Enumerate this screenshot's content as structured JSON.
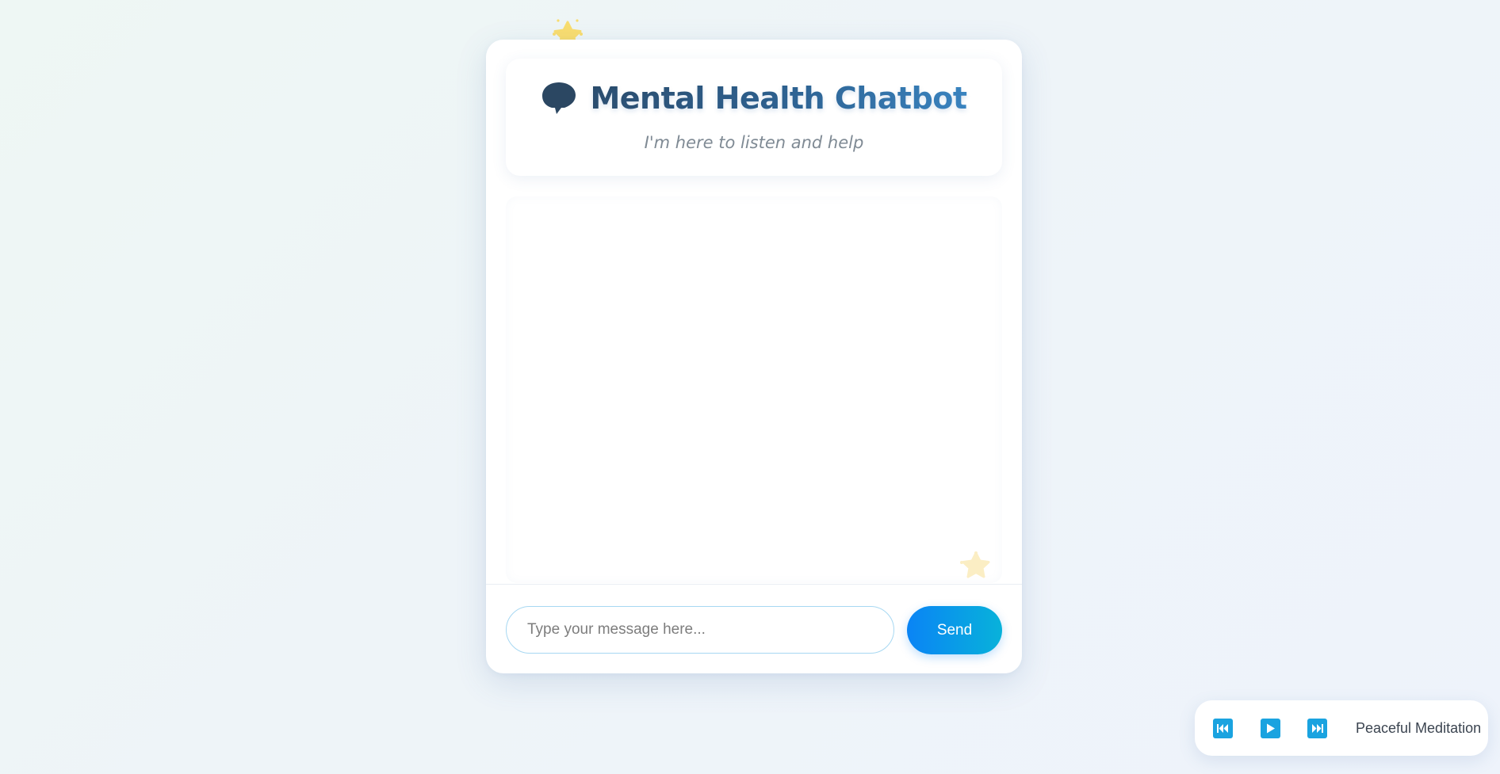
{
  "header": {
    "title": "Mental Health Chatbot",
    "subtitle": "I'm here to listen and help"
  },
  "chat": {
    "messages": []
  },
  "composer": {
    "placeholder": "Type your message here...",
    "value": "",
    "send_label": "Send"
  },
  "music_player": {
    "track_title": "Peaceful Meditation",
    "controls": [
      "previous-icon",
      "play-icon",
      "next-icon"
    ]
  },
  "colors": {
    "accent": "#0a84f5",
    "accent_end": "#08b2da",
    "title_dark": "#2a4a68",
    "title_light": "#3a86c2",
    "player_button": "#1aa3e0",
    "star": "#f9dd6f"
  }
}
